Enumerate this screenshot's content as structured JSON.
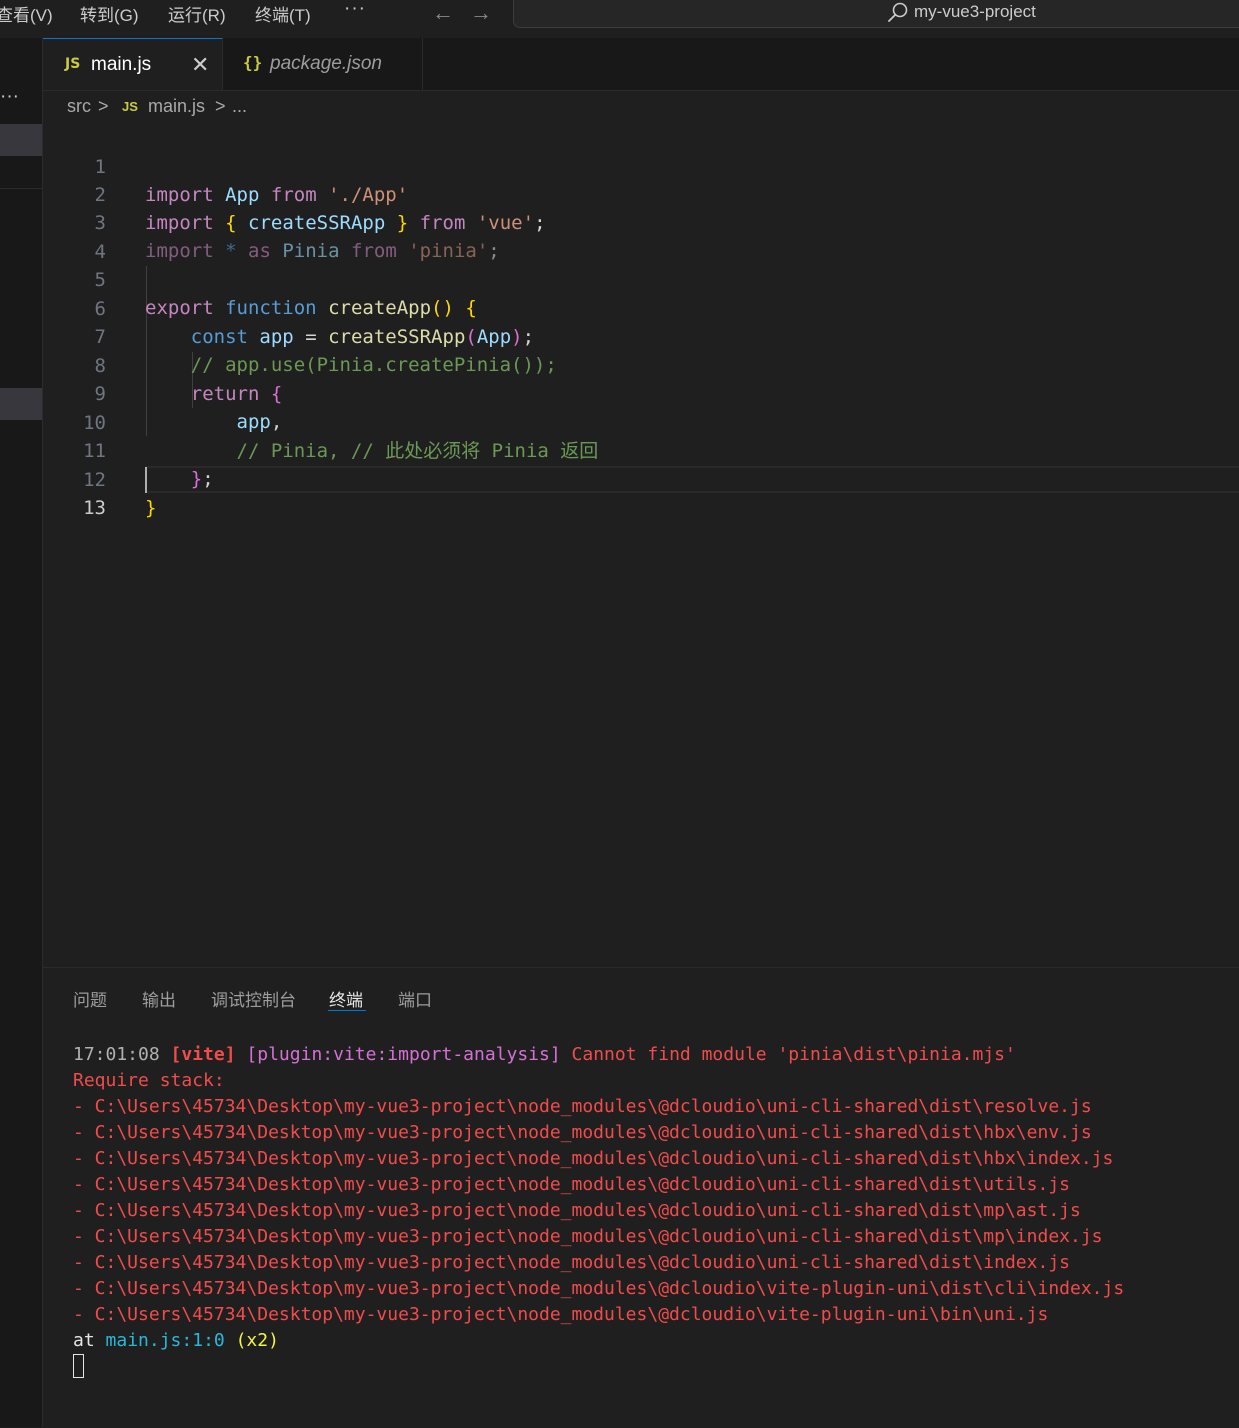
{
  "menubar": {
    "items": [
      "查看(V)",
      "转到(G)",
      "运行(R)",
      "终端(T)"
    ],
    "more": "···",
    "back_arrow": "←",
    "forward_arrow": "→",
    "search_icon": "search-icon",
    "project_name": "my-vue3-project"
  },
  "sidebar": {
    "more": "···"
  },
  "tabs": [
    {
      "icon": "JS",
      "label": "main.js",
      "active": true,
      "close": "✕"
    },
    {
      "icon": "{}",
      "label": "package.json",
      "active": false
    }
  ],
  "breadcrumb": {
    "folder": "src",
    "sep": ">",
    "file_icon": "JS",
    "file": "main.js",
    "more": "..."
  },
  "editor": {
    "line_numbers": [
      "1",
      "2",
      "3",
      "4",
      "5",
      "6",
      "7",
      "8",
      "9",
      "10",
      "11",
      "12",
      "13"
    ],
    "current_line": 13,
    "tokens": {
      "l1": [
        "import",
        "App",
        "from",
        "'./App'"
      ],
      "l2": [
        "import",
        "{",
        "createSSRApp",
        "}",
        "from",
        "'vue'",
        ";"
      ],
      "l3": [
        "import",
        "*",
        "as",
        "Pinia",
        "from",
        "'pinia'",
        ";"
      ],
      "l5": [
        "export",
        "function",
        "createApp",
        "()",
        "{"
      ],
      "l6": [
        "const",
        "app",
        "=",
        "createSSRApp",
        "(",
        "App",
        ")",
        ";"
      ],
      "l7": [
        "// app.use(Pinia.createPinia());"
      ],
      "l8": [
        "return",
        "{"
      ],
      "l9": [
        "app",
        ","
      ],
      "l10": [
        "// Pinia, // 此处必须将 Pinia 返回"
      ],
      "l11": [
        "}",
        ";"
      ],
      "l12": [
        "}"
      ]
    }
  },
  "panel": {
    "tabs": [
      "问题",
      "输出",
      "调试控制台",
      "终端",
      "端口"
    ],
    "active_tab": "终端",
    "terminal": {
      "time": "17:01:08",
      "vite_tag": "[vite]",
      "plugin_tag": "[plugin:vite:import-analysis]",
      "error_msg": "Cannot find module 'pinia\\dist\\pinia.mjs'",
      "require_stack": "Require stack:",
      "stack": [
        "- C:\\Users\\45734\\Desktop\\my-vue3-project\\node_modules\\@dcloudio\\uni-cli-shared\\dist\\resolve.js",
        "- C:\\Users\\45734\\Desktop\\my-vue3-project\\node_modules\\@dcloudio\\uni-cli-shared\\dist\\hbx\\env.js",
        "- C:\\Users\\45734\\Desktop\\my-vue3-project\\node_modules\\@dcloudio\\uni-cli-shared\\dist\\hbx\\index.js",
        "- C:\\Users\\45734\\Desktop\\my-vue3-project\\node_modules\\@dcloudio\\uni-cli-shared\\dist\\utils.js",
        "- C:\\Users\\45734\\Desktop\\my-vue3-project\\node_modules\\@dcloudio\\uni-cli-shared\\dist\\mp\\ast.js",
        "- C:\\Users\\45734\\Desktop\\my-vue3-project\\node_modules\\@dcloudio\\uni-cli-shared\\dist\\mp\\index.js",
        "- C:\\Users\\45734\\Desktop\\my-vue3-project\\node_modules\\@dcloudio\\uni-cli-shared\\dist\\index.js",
        "- C:\\Users\\45734\\Desktop\\my-vue3-project\\node_modules\\@dcloudio\\vite-plugin-uni\\dist\\cli\\index.js",
        "- C:\\Users\\45734\\Desktop\\my-vue3-project\\node_modules\\@dcloudio\\vite-plugin-uni\\bin\\uni.js"
      ],
      "at_word": "at",
      "at_location": "main.js:1:0",
      "at_count": "(x2)"
    }
  },
  "colors": {
    "background": "#1f1f1f",
    "accent": "#0078d4",
    "error": "#f14c4c",
    "keyword": "#c586c0",
    "storage": "#569cd6",
    "string": "#ce9178",
    "comment": "#6a9955",
    "function": "#dcdcaa"
  }
}
